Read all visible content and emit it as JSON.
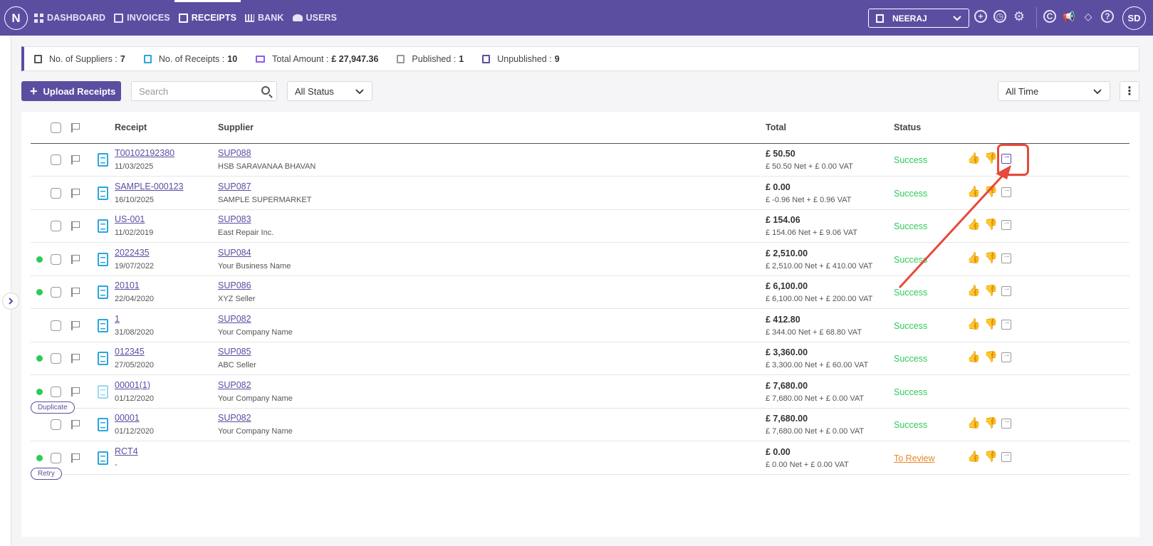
{
  "app": {
    "logo_letter": "N",
    "avatar_initials": "SD"
  },
  "nav": [
    {
      "label": "DASHBOARD",
      "icon": "dashboard-grid-icon"
    },
    {
      "label": "INVOICES",
      "icon": "invoice-icon"
    },
    {
      "label": "RECEIPTS",
      "icon": "receipt-icon",
      "active": true
    },
    {
      "label": "BANK",
      "icon": "bank-icon"
    },
    {
      "label": "USERS",
      "icon": "users-icon"
    }
  ],
  "org": {
    "selected": "NEERAJ"
  },
  "top_icons": [
    "add-circle-icon",
    "history-icon",
    "settings-gear-icon",
    "currency-c-icon",
    "megaphone-icon",
    "integrations-icon",
    "help-icon"
  ],
  "stats": {
    "suppliers_label": "No. of Suppliers :",
    "suppliers_value": "7",
    "receipts_label": "No. of Receipts :",
    "receipts_value": "10",
    "amount_label": "Total Amount :",
    "amount_value": "£ 27,947.36",
    "published_label": "Published :",
    "published_value": "1",
    "unpublished_label": "Unpublished :",
    "unpublished_value": "9"
  },
  "toolbar": {
    "upload_label": "Upload Receipts",
    "search_placeholder": "Search",
    "status_filter": "All Status",
    "time_filter": "All Time"
  },
  "table": {
    "headers": {
      "receipt": "Receipt",
      "supplier": "Supplier",
      "total": "Total",
      "status": "Status"
    },
    "rows": [
      {
        "receipt": "T00102192380",
        "date": "11/03/2025",
        "supplier_code": "SUP088",
        "supplier_name": "HSB SARAVANAA BHAVAN",
        "total": "£ 50.50",
        "breakdown": "£ 50.50 Net  + £ 0.00 VAT",
        "status": "Success",
        "dot": false
      },
      {
        "receipt": "SAMPLE-000123",
        "date": "16/10/2025",
        "supplier_code": "SUP087",
        "supplier_name": "SAMPLE SUPERMARKET",
        "total": "£ 0.00",
        "breakdown": "£ -0.96 Net  + £ 0.96 VAT",
        "status": "Success",
        "dot": false
      },
      {
        "receipt": "US-001",
        "date": "11/02/2019",
        "supplier_code": "SUP083",
        "supplier_name": "East Repair Inc.",
        "total": "£ 154.06",
        "breakdown": "£ 154.06 Net  + £ 9.06 VAT",
        "status": "Success",
        "dot": false
      },
      {
        "receipt": "2022435",
        "date": "19/07/2022",
        "supplier_code": "SUP084",
        "supplier_name": "Your Business Name",
        "total": "£ 2,510.00",
        "breakdown": "£ 2,510.00 Net  + £ 410.00 VAT",
        "status": "Success",
        "dot": true
      },
      {
        "receipt": "20101",
        "date": "22/04/2020",
        "supplier_code": "SUP086",
        "supplier_name": "XYZ Seller",
        "total": "£ 6,100.00",
        "breakdown": "£ 6,100.00 Net  + £ 200.00 VAT",
        "status": "Success",
        "dot": true
      },
      {
        "receipt": "1",
        "date": "31/08/2020",
        "supplier_code": "SUP082",
        "supplier_name": "Your Company Name",
        "total": "£ 412.80",
        "breakdown": "£ 344.00 Net  + £ 68.80 VAT",
        "status": "Success",
        "dot": false
      },
      {
        "receipt": "012345",
        "date": "27/05/2020",
        "supplier_code": "SUP085",
        "supplier_name": "ABC Seller",
        "total": "£ 3,360.00",
        "breakdown": "£ 3,300.00 Net  + £ 60.00 VAT",
        "status": "Success",
        "dot": true
      },
      {
        "receipt": "00001(1)",
        "date": "01/12/2020",
        "supplier_code": "SUP082",
        "supplier_name": "Your Company Name",
        "total": "£ 7,680.00",
        "breakdown": "£ 7,680.00 Net  + £ 0.00 VAT",
        "status": "Success",
        "dot": true,
        "badge": "Duplicate",
        "no_actions": true
      },
      {
        "receipt": "00001",
        "date": "01/12/2020",
        "supplier_code": "SUP082",
        "supplier_name": "Your Company Name",
        "total": "£ 7,680.00",
        "breakdown": "£ 7,680.00 Net  + £ 0.00 VAT",
        "status": "Success",
        "dot": false
      },
      {
        "receipt": "RCT4",
        "date": "-",
        "supplier_code": "",
        "supplier_name": "",
        "total": "£ 0.00",
        "breakdown": "£ 0.00 Net  + £ 0.00 VAT",
        "status": "To Review",
        "dot": true,
        "badge": "Retry"
      }
    ]
  },
  "colors": {
    "brand": "#5b4ea1",
    "success": "#2fca57",
    "danger": "#e0393e",
    "review": "#e8862a",
    "annotation": "#e64a3a"
  }
}
